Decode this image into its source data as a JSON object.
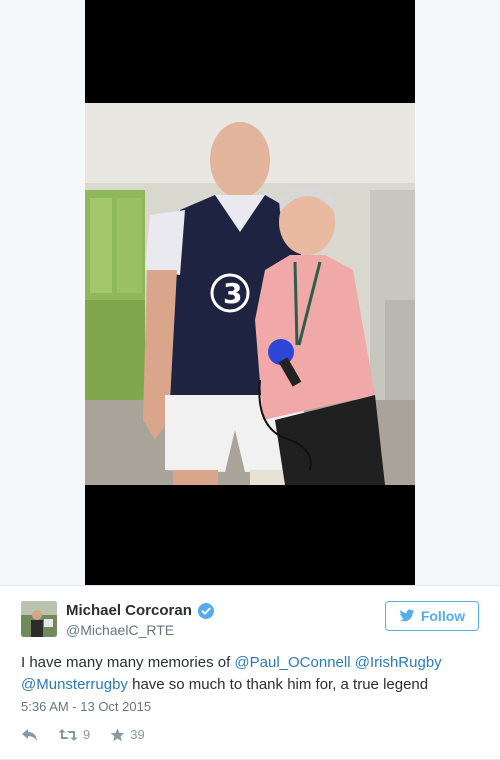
{
  "tweet": {
    "author": {
      "name": "Michael Corcoran",
      "handle": "@MichaelC_RTE",
      "verified": true
    },
    "follow_label": "Follow",
    "text_parts": [
      {
        "type": "text",
        "value": "I have many many memories of "
      },
      {
        "type": "mention",
        "value": "@Paul_OConnell"
      },
      {
        "type": "text",
        "value": " "
      },
      {
        "type": "mention",
        "value": "@IrishRugby"
      },
      {
        "type": "text",
        "value": " "
      },
      {
        "type": "mention",
        "value": "@Munsterrugby"
      },
      {
        "type": "text",
        "value": " have so much to thank him for, a true legend"
      }
    ],
    "timestamp": "5:36 AM - 13 Oct 2015",
    "retweet_count": "9",
    "like_count": "39"
  },
  "icons": {
    "verified": "verified-badge-icon",
    "follow": "bird-icon",
    "reply": "reply-icon",
    "retweet": "retweet-icon",
    "like": "star-icon"
  },
  "colors": {
    "accent": "#55acee",
    "mention": "#2b7bb9",
    "text": "#292f33",
    "muted": "#66757f"
  }
}
